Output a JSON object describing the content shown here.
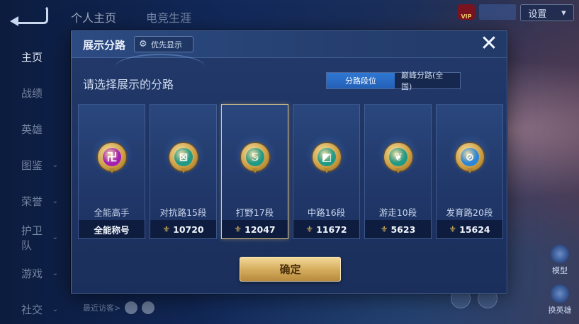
{
  "background": {
    "top_tabs": [
      "个人主页",
      "电竞生涯"
    ],
    "nav_items": [
      {
        "label": "主页",
        "active": true,
        "chevron": false
      },
      {
        "label": "战绩",
        "active": false,
        "chevron": false
      },
      {
        "label": "英雄",
        "active": false,
        "chevron": false
      },
      {
        "label": "图鉴",
        "active": false,
        "chevron": true
      },
      {
        "label": "荣誉",
        "active": false,
        "chevron": true
      },
      {
        "label": "护卫队",
        "active": false,
        "chevron": true
      },
      {
        "label": "游戏",
        "active": false,
        "chevron": true
      },
      {
        "label": "社交",
        "active": false,
        "chevron": true
      }
    ],
    "settings_label": "设置",
    "vip_label": "VIP",
    "recent_visitors_label": "最近访客>",
    "right_side": {
      "model_label": "模型",
      "switch_hero_label": "换英雄"
    }
  },
  "dialog": {
    "title": "展示分路",
    "priority_button": "优先显示",
    "prompt": "请选择展示的分路",
    "toggle": {
      "active": "分路段位",
      "inactive": "巅峰分路(全国)"
    },
    "cards": [
      {
        "name": "全能高手",
        "footer": "全能称号",
        "show_wings": false,
        "glyph": "卍",
        "badge_color": "#a31fb3",
        "selected": false
      },
      {
        "name": "对抗路15段",
        "footer": "10720",
        "show_wings": true,
        "glyph": "⊠",
        "badge_color": "#1f9a86",
        "selected": false
      },
      {
        "name": "打野17段",
        "footer": "12047",
        "show_wings": true,
        "glyph": "𝕊",
        "badge_color": "#1f9a86",
        "selected": true
      },
      {
        "name": "中路16段",
        "footer": "11672",
        "show_wings": true,
        "glyph": "◩",
        "badge_color": "#1f9a86",
        "selected": false
      },
      {
        "name": "游走10段",
        "footer": "5623",
        "show_wings": true,
        "glyph": "❦",
        "badge_color": "#1f9a86",
        "selected": false
      },
      {
        "name": "发育路20段",
        "footer": "15624",
        "show_wings": true,
        "glyph": "⊘",
        "badge_color": "#2a86d9",
        "selected": false
      }
    ],
    "confirm_button": "确定",
    "close_symbol": "✕",
    "accent_color": "#2f78d4",
    "gold_color": "#d9b264"
  }
}
